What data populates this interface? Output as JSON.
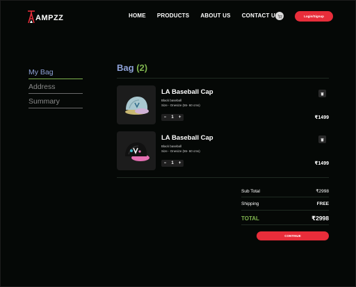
{
  "brand": {
    "name": "AMPZZ"
  },
  "nav": {
    "links": [
      "HOME",
      "PRODUCTS",
      "ABOUT US",
      "CONTACT US"
    ],
    "login_label": "Login/Signup"
  },
  "sidebar": {
    "items": [
      {
        "label": "My Bag",
        "active": true
      },
      {
        "label": "Address",
        "active": false
      },
      {
        "label": "Summary",
        "active": false
      }
    ]
  },
  "bag": {
    "title": "Bag",
    "count_label": "(2)",
    "items": [
      {
        "name": "LA Baseball Cap",
        "desc1": "Black baseball",
        "desc2": "Size - Onesize (55- 60 cms)",
        "qty": "1",
        "minus": "−",
        "plus": "+",
        "price": "₹1499"
      },
      {
        "name": "LA Baseball Cap",
        "desc1": "Black baseball",
        "desc2": "Size - Onesize (55- 60 cms)",
        "qty": "1",
        "minus": "−",
        "plus": "+",
        "price": "₹1499"
      }
    ]
  },
  "summary": {
    "subtotal_label": "Sub Total",
    "subtotal_value": "₹2998",
    "shipping_label": "Shipping",
    "shipping_value": "FREE",
    "total_label": "TOTAL",
    "total_value": "₹2998",
    "continue_label": "CONTINUE"
  },
  "colors": {
    "accent_red": "#e82d3a",
    "accent_blue": "#8fa2d9",
    "accent_green": "#7fb44e",
    "background": "#050806"
  },
  "icons": [
    "logo-figure-icon",
    "cart-icon",
    "trash-icon",
    "cap-light-icon",
    "cap-dark-icon"
  ]
}
